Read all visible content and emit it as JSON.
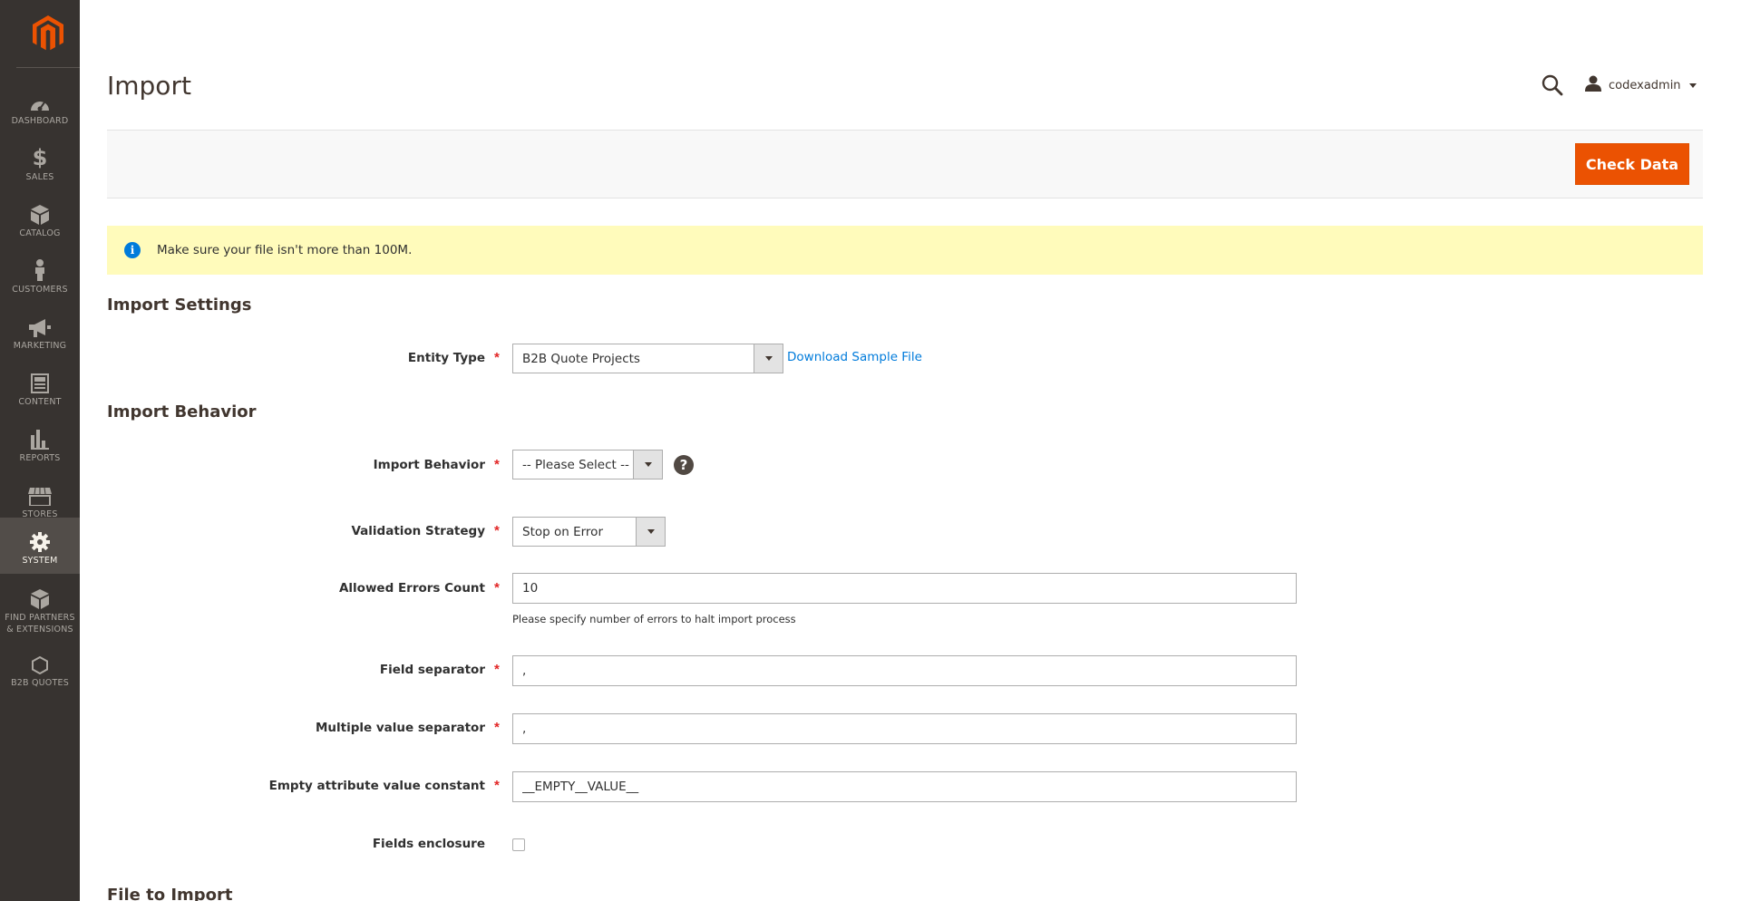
{
  "sidebar": {
    "logo": "magento-logo",
    "items": [
      {
        "label": "DASHBOARD",
        "icon": "dashboard-icon"
      },
      {
        "label": "SALES",
        "icon": "dollar-icon"
      },
      {
        "label": "CATALOG",
        "icon": "box-icon"
      },
      {
        "label": "CUSTOMERS",
        "icon": "person-icon"
      },
      {
        "label": "MARKETING",
        "icon": "megaphone-icon"
      },
      {
        "label": "CONTENT",
        "icon": "layout-icon"
      },
      {
        "label": "REPORTS",
        "icon": "bar-chart-icon"
      },
      {
        "label": "STORES",
        "icon": "storefront-icon"
      },
      {
        "label": "SYSTEM",
        "icon": "gear-icon",
        "active": true
      },
      {
        "label": "FIND PARTNERS",
        "label2": "& EXTENSIONS",
        "icon": "cubes-icon"
      },
      {
        "label": "B2B QUOTES",
        "icon": "hexagon-icon"
      }
    ]
  },
  "header": {
    "title": "Import",
    "user": "codexadmin"
  },
  "actions": {
    "check_data": "Check Data"
  },
  "message": {
    "text": "Make sure your file isn't more than 100M."
  },
  "import_settings": {
    "title": "Import Settings",
    "entity_type_label": "Entity Type",
    "entity_type_value": "B2B Quote Projects",
    "download_link": "Download Sample File"
  },
  "import_behavior": {
    "title": "Import Behavior",
    "behavior_label": "Import Behavior",
    "behavior_value": "-- Please Select --",
    "validation_label": "Validation Strategy",
    "validation_value": "Stop on Error",
    "errors_label": "Allowed Errors Count",
    "errors_value": "10",
    "errors_note": "Please specify number of errors to halt import process",
    "field_sep_label": "Field separator",
    "field_sep_value": ",",
    "multi_sep_label": "Multiple value separator",
    "multi_sep_value": ",",
    "empty_const_label": "Empty attribute value constant",
    "empty_const_value": "__EMPTY__VALUE__",
    "enclosure_label": "Fields enclosure"
  },
  "file_to_import": {
    "title": "File to Import"
  },
  "colors": {
    "sidebar_bg": "#373330",
    "accent": "#eb5202",
    "link": "#007bdb",
    "notice_bg": "#fffbbb"
  }
}
